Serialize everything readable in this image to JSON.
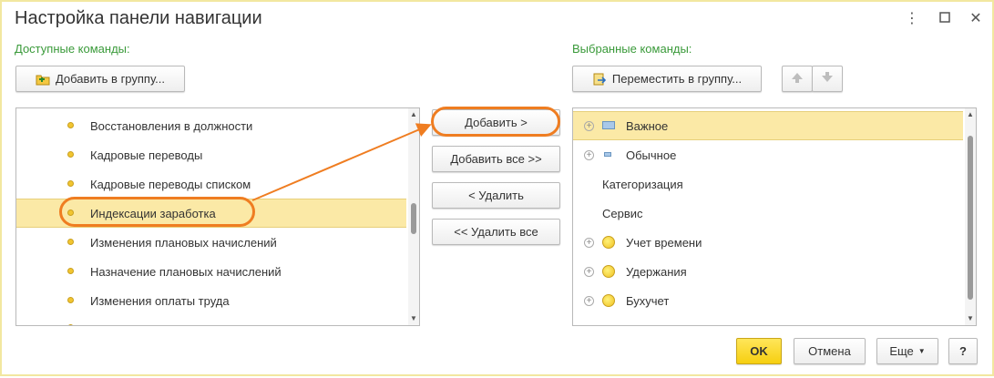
{
  "window": {
    "title": "Настройка панели навигации",
    "menu_icon": "more-vertical-icon",
    "maximize_icon": "maximize-icon",
    "close_icon": "close-icon"
  },
  "left": {
    "label": "Доступные команды:",
    "add_to_group_label": "Добавить в группу...",
    "items": [
      {
        "label": "Восстановления в должности"
      },
      {
        "label": "Кадровые переводы"
      },
      {
        "label": "Кадровые переводы списком"
      },
      {
        "label": "Индексации заработка",
        "selected": true
      },
      {
        "label": "Изменения плановых начислений"
      },
      {
        "label": "Назначение плановых начислений"
      },
      {
        "label": "Изменения оплаты труда"
      }
    ]
  },
  "middle": {
    "add": "Добавить >",
    "add_all": "Добавить все >>",
    "remove": "< Удалить",
    "remove_all": "<< Удалить все"
  },
  "right": {
    "label": "Выбранные команды:",
    "move_to_group_label": "Переместить в группу...",
    "items": [
      {
        "label": "Важное",
        "expandable": true,
        "icon": "important-group-icon",
        "selected": true
      },
      {
        "label": "Обычное",
        "expandable": true,
        "icon": "normal-group-icon"
      },
      {
        "label": "Категоризация"
      },
      {
        "label": "Сервис"
      },
      {
        "label": "Учет времени",
        "expandable": true,
        "icon": "yellow-circle-icon"
      },
      {
        "label": "Удержания",
        "expandable": true,
        "icon": "yellow-circle-icon"
      },
      {
        "label": "Бухучет",
        "expandable": true,
        "icon": "yellow-circle-icon"
      }
    ]
  },
  "footer": {
    "ok": "OK",
    "cancel": "Отмена",
    "more": "Еще",
    "help": "?"
  },
  "colors": {
    "accent_green": "#3a9a3a",
    "selection": "#fbe9a6",
    "annotation_orange": "#ef7d21",
    "ok_yellow": "#f6cf10"
  }
}
